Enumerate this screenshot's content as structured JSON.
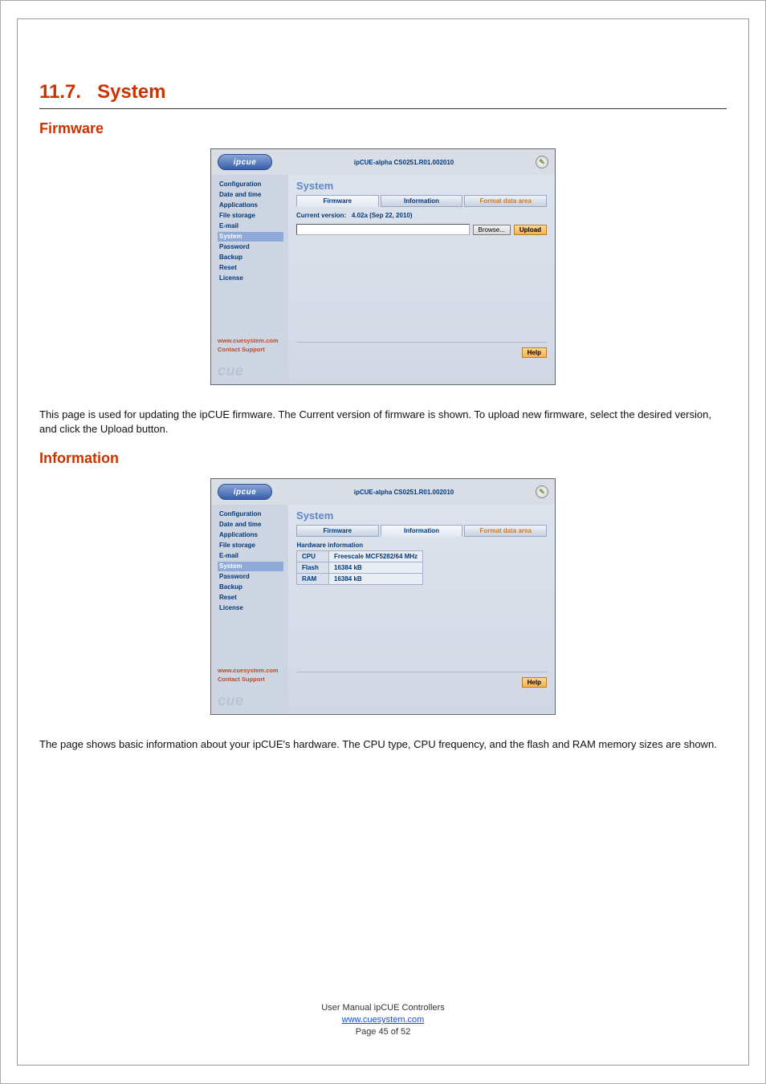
{
  "doc": {
    "section_number": "11.7.",
    "section_title": "System",
    "sub1": "Firmware",
    "sub2": "Information",
    "para1": "This page is used for updating the ipCUE firmware. The Current version of firmware is shown. To upload new firmware, select the desired version, and click the Upload button.",
    "para2": "The page shows basic information about your ipCUE's hardware. The CPU type, CPU frequency, and the flash and RAM memory sizes are shown.",
    "footer_line1": "User Manual ipCUE Controllers",
    "footer_link": "www.cuesystem.com",
    "footer_page": "Page 45 of 52"
  },
  "admin": {
    "logo_text": "ipcue",
    "header_title": "ipCUE-alpha   CS0251.R01.002010",
    "side_items": [
      "Configuration",
      "Date and time",
      "Applications",
      "File storage",
      "E-mail",
      "System",
      "Password",
      "Backup",
      "Reset",
      "License"
    ],
    "selected_side": "System",
    "main_heading": "System",
    "tabs": {
      "firmware": "Firmware",
      "information": "Information",
      "format": "Format data area"
    },
    "current_version_label": "Current version:",
    "current_version_value": "4.02a (Sep 22, 2010)",
    "browse_label": "Browse...",
    "upload_label": "Upload",
    "help_label": "Help",
    "hw_heading": "Hardware information",
    "hw_rows": {
      "cpu_label": "CPU",
      "cpu_value": "Freescale MCF5282/64 MHz",
      "flash_label": "Flash",
      "flash_value": "16384 kB",
      "ram_label": "RAM",
      "ram_value": "16384 kB"
    },
    "footer_links": {
      "site": "www.cuesystem.com",
      "support": "Contact Support"
    },
    "footer_brand": "cue"
  }
}
